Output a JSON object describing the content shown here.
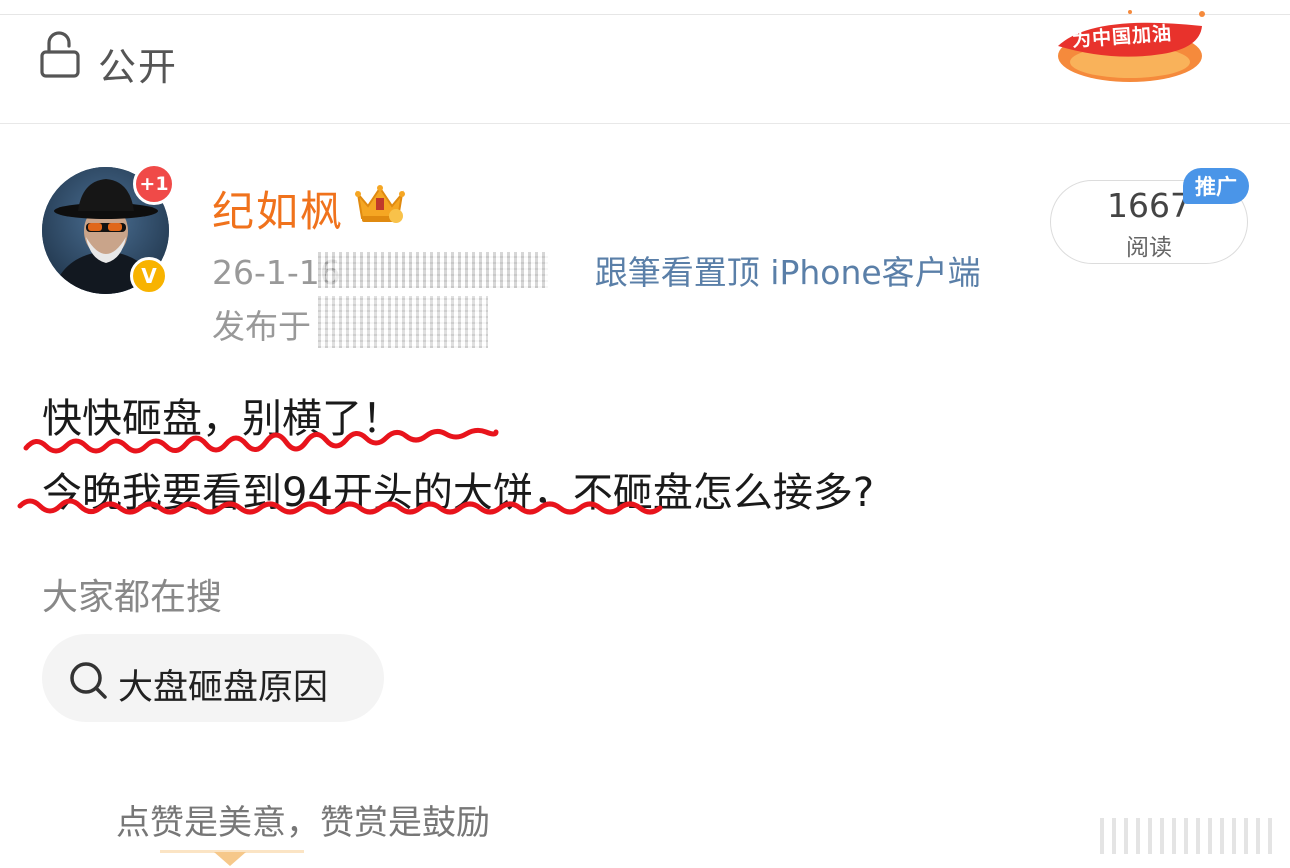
{
  "header": {
    "privacy_label": "公开",
    "banner_text": "为中国加油"
  },
  "author": {
    "name": "纪如枫",
    "notification_count": "+1",
    "verified_mark": "V",
    "meta_time_prefix": "26-1-16",
    "meta_source": "跟筆看置顶 iPhone客户端",
    "meta_location_prefix": "发布于"
  },
  "stats": {
    "read_count": "1667",
    "read_label": "阅读",
    "promo_tag": "推广"
  },
  "post": {
    "line1": "快快砸盘，别横了！",
    "line2": "今晚我要看到94开头的大饼，不砸盘怎么接多?"
  },
  "search": {
    "heading": "大家都在搜",
    "chip_text": "大盘砸盘原因"
  },
  "reward": {
    "text": "点赞是美意，赞赏是鼓励"
  },
  "colors": {
    "username": "#f0721c",
    "source_link": "#5a7fa8",
    "notification": "#f04a48",
    "verified": "#f8b300",
    "promo": "#4a95e8",
    "underline": "#e8141c"
  }
}
